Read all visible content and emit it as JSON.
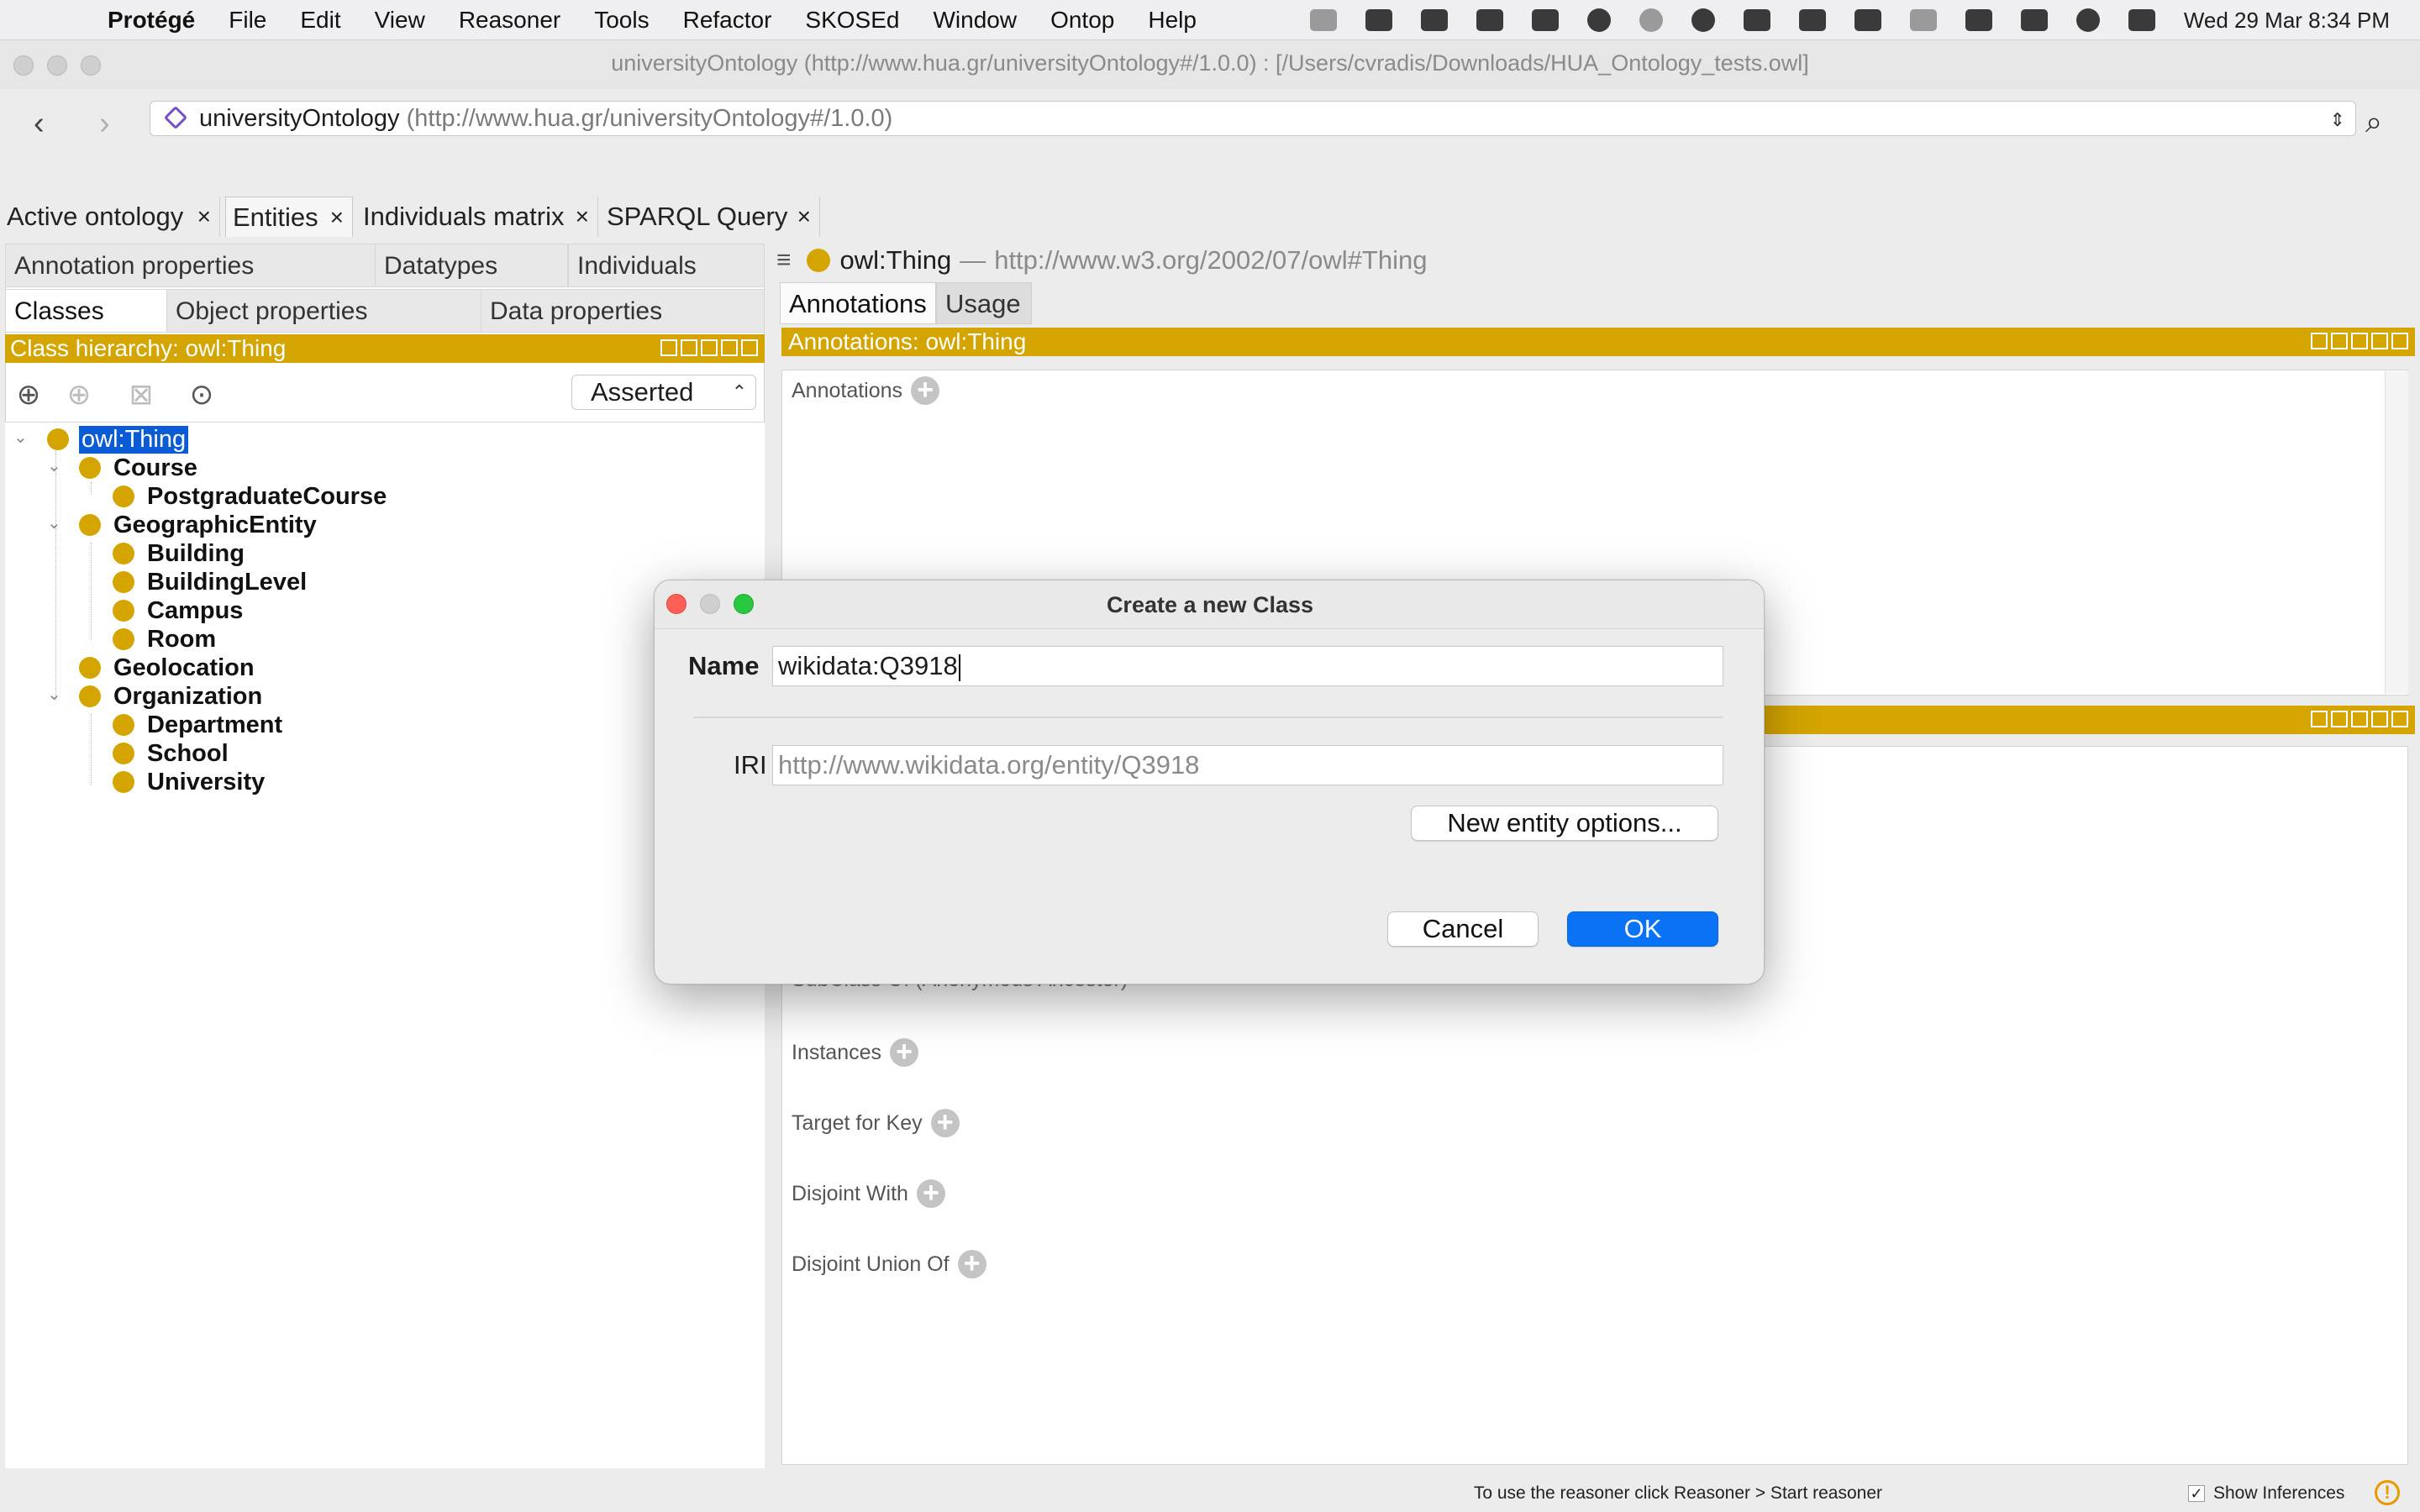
{
  "menubar": {
    "app_name": "Protégé",
    "items": [
      "File",
      "Edit",
      "View",
      "Reasoner",
      "Tools",
      "Refactor",
      "SKOSEd",
      "Window",
      "Ontop",
      "Help"
    ],
    "clock": "Wed 29 Mar  8:34 PM"
  },
  "window": {
    "title": "universityOntology (http://www.hua.gr/universityOntology#/1.0.0)  : [/Users/cvradis/Downloads/HUA_Ontology_tests.owl]"
  },
  "address": {
    "name": "universityOntology",
    "iri": "(http://www.hua.gr/universityOntology#/1.0.0)"
  },
  "workspace_tabs": [
    {
      "label": "Active ontology"
    },
    {
      "label": "Entities"
    },
    {
      "label": "Individuals matrix"
    },
    {
      "label": "SPARQL Query"
    }
  ],
  "entity_tabs": {
    "row1": [
      "Annotation properties",
      "Datatypes",
      "Individuals"
    ],
    "row2": [
      "Classes",
      "Object properties",
      "Data properties"
    ]
  },
  "class_hierarchy": {
    "header": "Class hierarchy: owl:Thing",
    "mode": "Asserted",
    "nodes": [
      {
        "label": "owl:Thing"
      },
      {
        "label": "Course"
      },
      {
        "label": "PostgraduateCourse"
      },
      {
        "label": "GeographicEntity"
      },
      {
        "label": "Building"
      },
      {
        "label": "BuildingLevel"
      },
      {
        "label": "Campus"
      },
      {
        "label": "Room"
      },
      {
        "label": "Geolocation"
      },
      {
        "label": "Organization"
      },
      {
        "label": "Department"
      },
      {
        "label": "School"
      },
      {
        "label": "University"
      }
    ]
  },
  "entity": {
    "name": "owl:Thing",
    "dash": "—",
    "iri": "http://www.w3.org/2002/07/owl#Thing",
    "tabs": [
      "Annotations",
      "Usage"
    ],
    "annotations_header": "Annotations: owl:Thing",
    "annotations_label": "Annotations",
    "description_frames": [
      "SubClass Of (Anonymous Ancestor)",
      "Instances",
      "Target for Key",
      "Disjoint With",
      "Disjoint Union Of"
    ]
  },
  "dialog": {
    "title": "Create a new Class",
    "name_label": "Name",
    "name_value": "wikidata:Q3918",
    "iri_label": "IRI",
    "iri_value": "http://www.wikidata.org/entity/Q3918",
    "options_button": "New entity options...",
    "cancel": "Cancel",
    "ok": "OK"
  },
  "statusbar": {
    "message": "To use the reasoner click Reasoner > Start reasoner",
    "show_inferences": "Show Inferences",
    "show_inferences_checked": true
  },
  "colors": {
    "class_gold": "#d4a500",
    "selection_blue": "#0b5bd7",
    "ok_blue": "#0a72f5"
  }
}
